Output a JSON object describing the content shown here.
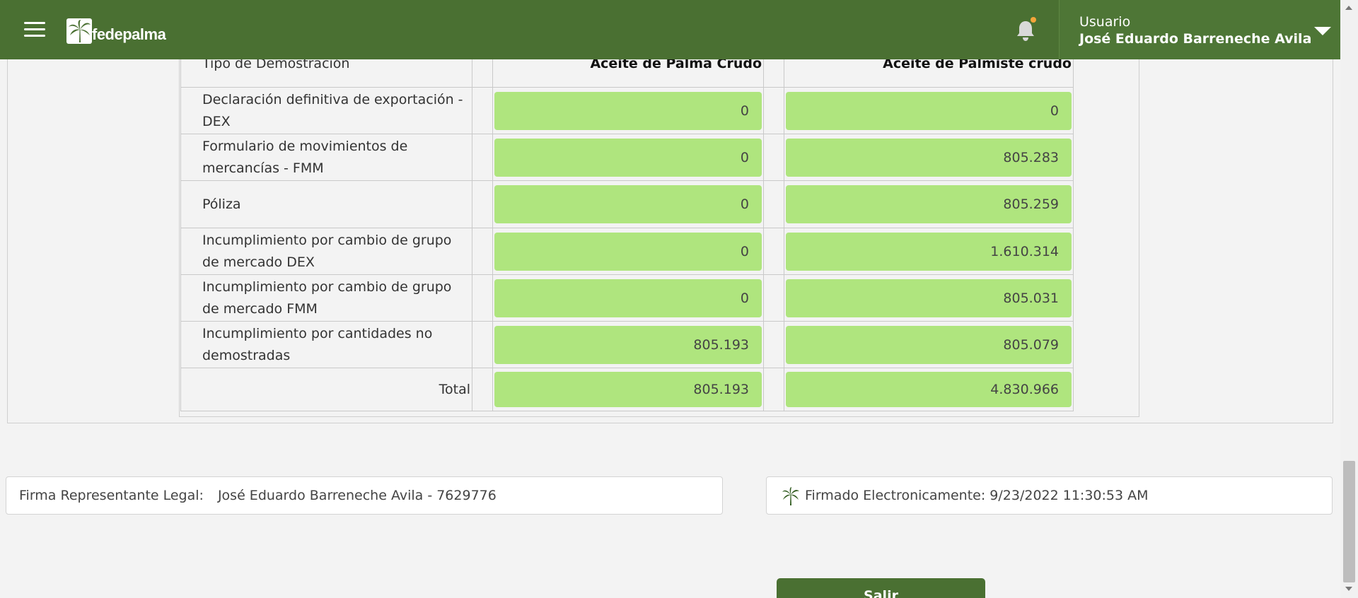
{
  "header": {
    "brand": "fedepalma",
    "user_label": "Usuario",
    "user_name": "José Eduardo Barreneche Avila",
    "notification_dot_color": "#f4a53a",
    "bar_color": "#4a7032"
  },
  "table": {
    "columns": [
      "Tipo de Demostración",
      "",
      "Aceite de Palma Crudo",
      "",
      "Aceite de Palmiste crudo"
    ],
    "rows": [
      {
        "label": "Declaración definitiva de exportación - DEX",
        "palma": "0",
        "palmiste": "0"
      },
      {
        "label": "Formulario de movimientos de mercancías - FMM",
        "palma": "0",
        "palmiste": "805.283"
      },
      {
        "label": "Póliza",
        "palma": "0",
        "palmiste": "805.259"
      },
      {
        "label": "Incumplimiento por cambio de grupo de mercado DEX",
        "palma": "0",
        "palmiste": "1.610.314"
      },
      {
        "label": "Incumplimiento por cambio de grupo de mercado FMM",
        "palma": "0",
        "palmiste": "805.031"
      },
      {
        "label": "Incumplimiento por cantidades no demostradas",
        "palma": "805.193",
        "palmiste": "805.079"
      }
    ],
    "total": {
      "label": "Total",
      "palma": "805.193",
      "palmiste": "4.830.966"
    },
    "value_bg_color": "#afe57e"
  },
  "signature": {
    "label": "Firma Representante Legal:",
    "value": "José Eduardo Barreneche Avila - 7629776",
    "signed_text": "Firmado Electronicamente: 9/23/2022 11:30:53 AM"
  },
  "actions": {
    "exit_label": "Salir"
  }
}
